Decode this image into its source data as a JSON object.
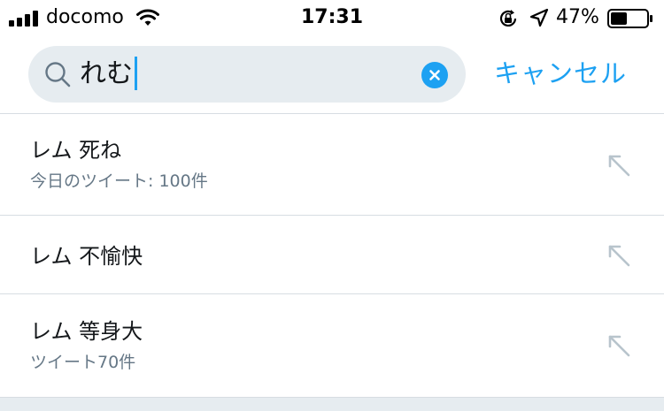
{
  "status_bar": {
    "carrier": "docomo",
    "time": "17:31",
    "battery_percent": "47%",
    "battery_level": 0.47,
    "icons": [
      "signal-icon",
      "wifi-icon",
      "rotation-lock-icon",
      "location-icon",
      "battery-icon"
    ]
  },
  "search": {
    "value": "れむ",
    "cancel_label": "キャンセル"
  },
  "suggestions": [
    {
      "title": "レム 死ね",
      "subtitle": "今日のツイート: 100件"
    },
    {
      "title": "レム 不愉快",
      "subtitle": ""
    },
    {
      "title": "レム 等身大",
      "subtitle": "ツイート70件"
    }
  ],
  "colors": {
    "accent": "#1da1f2",
    "field_bg": "#e6ecf0",
    "secondary_text": "#657786",
    "icon_gray": "#b8c4cc"
  }
}
